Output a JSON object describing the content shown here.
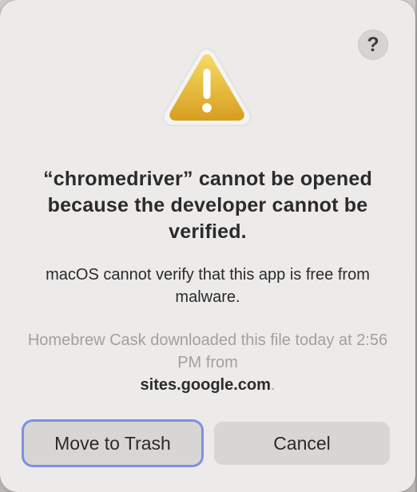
{
  "dialog": {
    "help_label": "?",
    "title": "“chromedriver” cannot be opened because the developer cannot be verified.",
    "message": "macOS cannot verify that this app is free from malware.",
    "info_prefix": "Homebrew Cask downloaded this file today at 2:56 PM from",
    "info_site": "sites.google.com",
    "info_suffix": ".",
    "icon": "warning-icon",
    "buttons": {
      "move_to_trash": "Move to Trash",
      "cancel": "Cancel"
    },
    "colors": {
      "background": "#ecebea",
      "button": "#d8d6d4",
      "focus_ring": "#7f8fe3",
      "warning_fill": "#f0c63b",
      "text": "#2b2b2b",
      "muted_text": "#a2a09e"
    }
  }
}
